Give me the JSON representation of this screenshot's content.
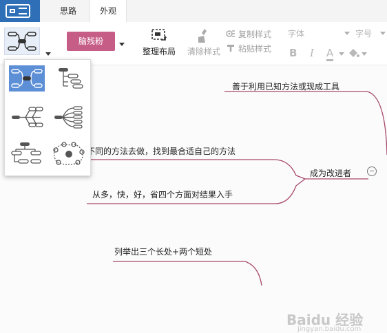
{
  "tabs": {
    "ideas": "思路",
    "appearance": "外观"
  },
  "toolbar": {
    "theme_label": "脑残粉",
    "organize_label": "整理布局",
    "clear_style_label": "清除样式",
    "copy_style_label": "复制样式",
    "paste_style_label": "粘贴样式",
    "font_label": "字体",
    "size_label": "字号",
    "bold_label": "B",
    "italic_label": "I",
    "fontcolor_label": "A"
  },
  "colors": {
    "accent": "#c65d86",
    "branch": "#a6476b",
    "selected": "#5d8fd6",
    "app_icon": "#2f6fb7"
  },
  "mindmap": {
    "central": "成为改进者",
    "topics": [
      "善于利用已知方法或现成工具",
      "不同的方法去做，找到最合适自己的方法",
      "从多，快，好，省四个方面对结果入手",
      "列举出三个长处+两个短处"
    ]
  },
  "watermark": {
    "text": "Baidu 经验",
    "sub": "jingyan.baidu.com"
  },
  "icons": [
    "app-icon",
    "layout-icon",
    "organize-layout-icon",
    "clear-style-icon",
    "copy-style-icon",
    "paste-style-icon",
    "background-color-icon",
    "collapse-icon"
  ]
}
